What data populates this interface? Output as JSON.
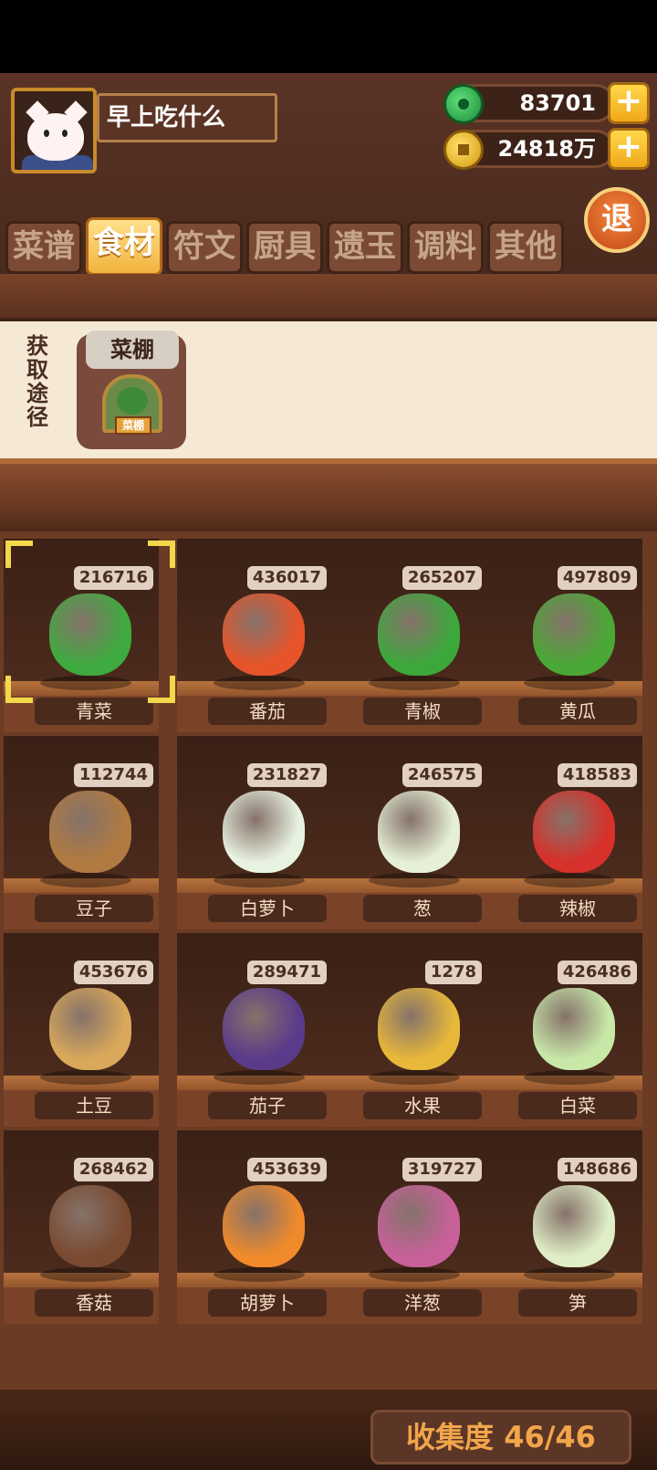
{
  "player": {
    "name": "早上吃什么"
  },
  "currency": {
    "jade": "83701",
    "coins": "24818万"
  },
  "exit_label": "退",
  "tabs": [
    "菜谱",
    "食材",
    "符文",
    "厨具",
    "遗玉",
    "调料",
    "其他"
  ],
  "active_tab": "食材",
  "source": {
    "label": "获取途径",
    "card_title": "菜棚",
    "sign_text": "菜棚"
  },
  "items": [
    {
      "name": "青菜",
      "count": "216716",
      "icon": "bok-choy-icon"
    },
    {
      "name": "番茄",
      "count": "436017",
      "icon": "tomato-icon"
    },
    {
      "name": "青椒",
      "count": "265207",
      "icon": "green-pepper-icon"
    },
    {
      "name": "黄瓜",
      "count": "497809",
      "icon": "cucumber-icon"
    },
    {
      "name": "豆子",
      "count": "112744",
      "icon": "beans-box-icon"
    },
    {
      "name": "白萝卜",
      "count": "231827",
      "icon": "white-radish-icon"
    },
    {
      "name": "葱",
      "count": "246575",
      "icon": "scallion-icon"
    },
    {
      "name": "辣椒",
      "count": "418583",
      "icon": "chili-icon"
    },
    {
      "name": "土豆",
      "count": "453676",
      "icon": "potato-icon"
    },
    {
      "name": "茄子",
      "count": "289471",
      "icon": "eggplant-icon"
    },
    {
      "name": "水果",
      "count": "1278",
      "icon": "fruit-icon"
    },
    {
      "name": "白菜",
      "count": "426486",
      "icon": "cabbage-icon"
    },
    {
      "name": "香菇",
      "count": "268462",
      "icon": "mushroom-icon"
    },
    {
      "name": "胡萝卜",
      "count": "453639",
      "icon": "carrot-icon"
    },
    {
      "name": "洋葱",
      "count": "319727",
      "icon": "onion-icon"
    },
    {
      "name": "笋",
      "count": "148686",
      "icon": "bamboo-shoot-icon"
    }
  ],
  "collection": {
    "label": "收集度 46/46"
  }
}
